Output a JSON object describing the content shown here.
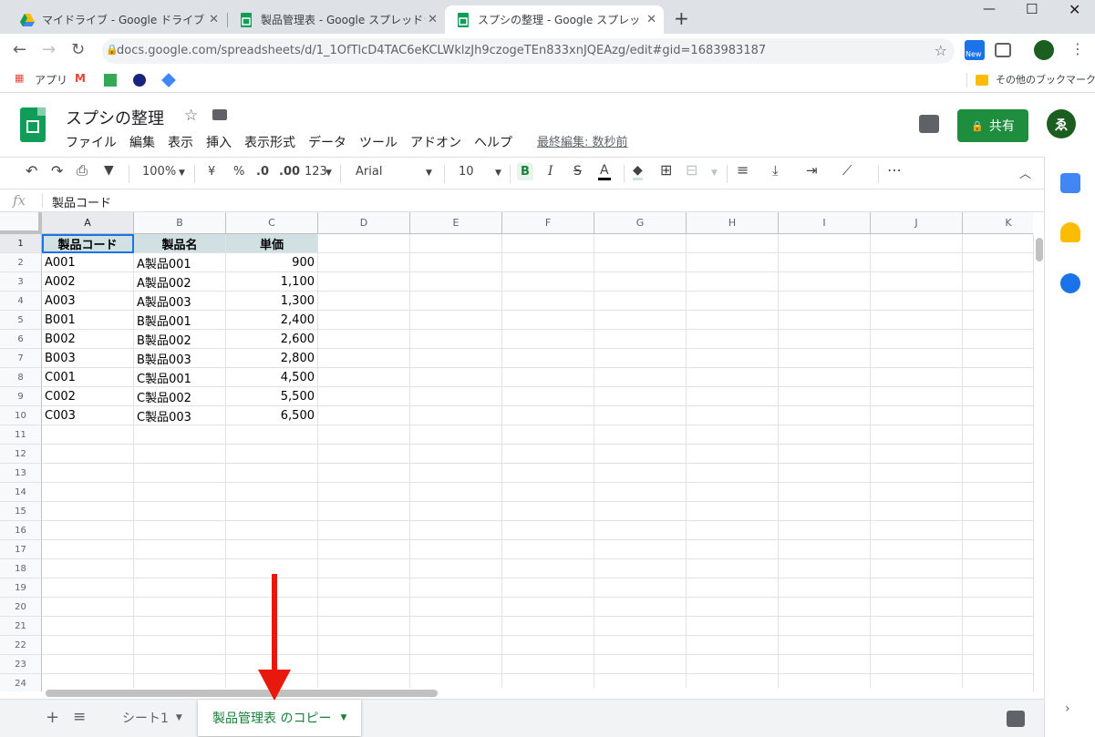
{
  "browser": {
    "tabs": [
      {
        "title": "マイドライブ - Google ドライブ"
      },
      {
        "title": "製品管理表 - Google スプレッドシ-"
      },
      {
        "title": "スプシの整理 - Google スプレッドシ-"
      }
    ],
    "url": "docs.google.com/spreadsheets/d/1_1OfTlcD4TAC6eKCLWklzJh9czogeTEn833xnJQEAzg/edit#gid=1683983187",
    "ext_new_badge": "New",
    "bookmarks": {
      "apps": "アプリ",
      "other": "その他のブックマーク"
    }
  },
  "sheets": {
    "title": "スプシの整理",
    "menu": [
      "ファイル",
      "編集",
      "表示",
      "挿入",
      "表示形式",
      "データ",
      "ツール",
      "アドオン",
      "ヘルプ"
    ],
    "last_edit": "最終編集: 数秒前",
    "share_label": "共有",
    "avatar_label": "ゑ",
    "toolbar": {
      "zoom": "100%",
      "currency": "¥",
      "percent": "%",
      "dec_less": ".0",
      "dec_more": ".00",
      "format_more": "123",
      "font": "Arial",
      "font_size": "10",
      "bold": "B",
      "italic": "I",
      "strike": "S",
      "text_color": "A"
    },
    "formula_bar": {
      "fx": "fx",
      "value": "製品コード"
    },
    "columns": [
      "A",
      "B",
      "C",
      "D",
      "E",
      "F",
      "G",
      "H",
      "I",
      "J",
      "K"
    ],
    "rows": [
      "1",
      "2",
      "3",
      "4",
      "5",
      "6",
      "7",
      "8",
      "9",
      "10",
      "11",
      "12",
      "13",
      "14",
      "15",
      "16",
      "17",
      "18",
      "19",
      "20",
      "21",
      "22",
      "23",
      "24"
    ],
    "header": [
      "製品コード",
      "製品名",
      "単価"
    ],
    "data": [
      [
        "A001",
        "A製品001",
        "900"
      ],
      [
        "A002",
        "A製品002",
        "1,100"
      ],
      [
        "A003",
        "A製品003",
        "1,300"
      ],
      [
        "B001",
        "B製品001",
        "2,400"
      ],
      [
        "B002",
        "B製品002",
        "2,600"
      ],
      [
        "B003",
        "B製品003",
        "2,800"
      ],
      [
        "C001",
        "C製品001",
        "4,500"
      ],
      [
        "C002",
        "C製品002",
        "5,500"
      ],
      [
        "C003",
        "C製品003",
        "6,500"
      ]
    ],
    "sheet_tabs": [
      {
        "label": "シート1"
      },
      {
        "label": "製品管理表 のコピー"
      }
    ],
    "colors": {
      "header_fill": "#d0e0e3",
      "accent": "#188038",
      "arrow": "#e8180c"
    }
  }
}
